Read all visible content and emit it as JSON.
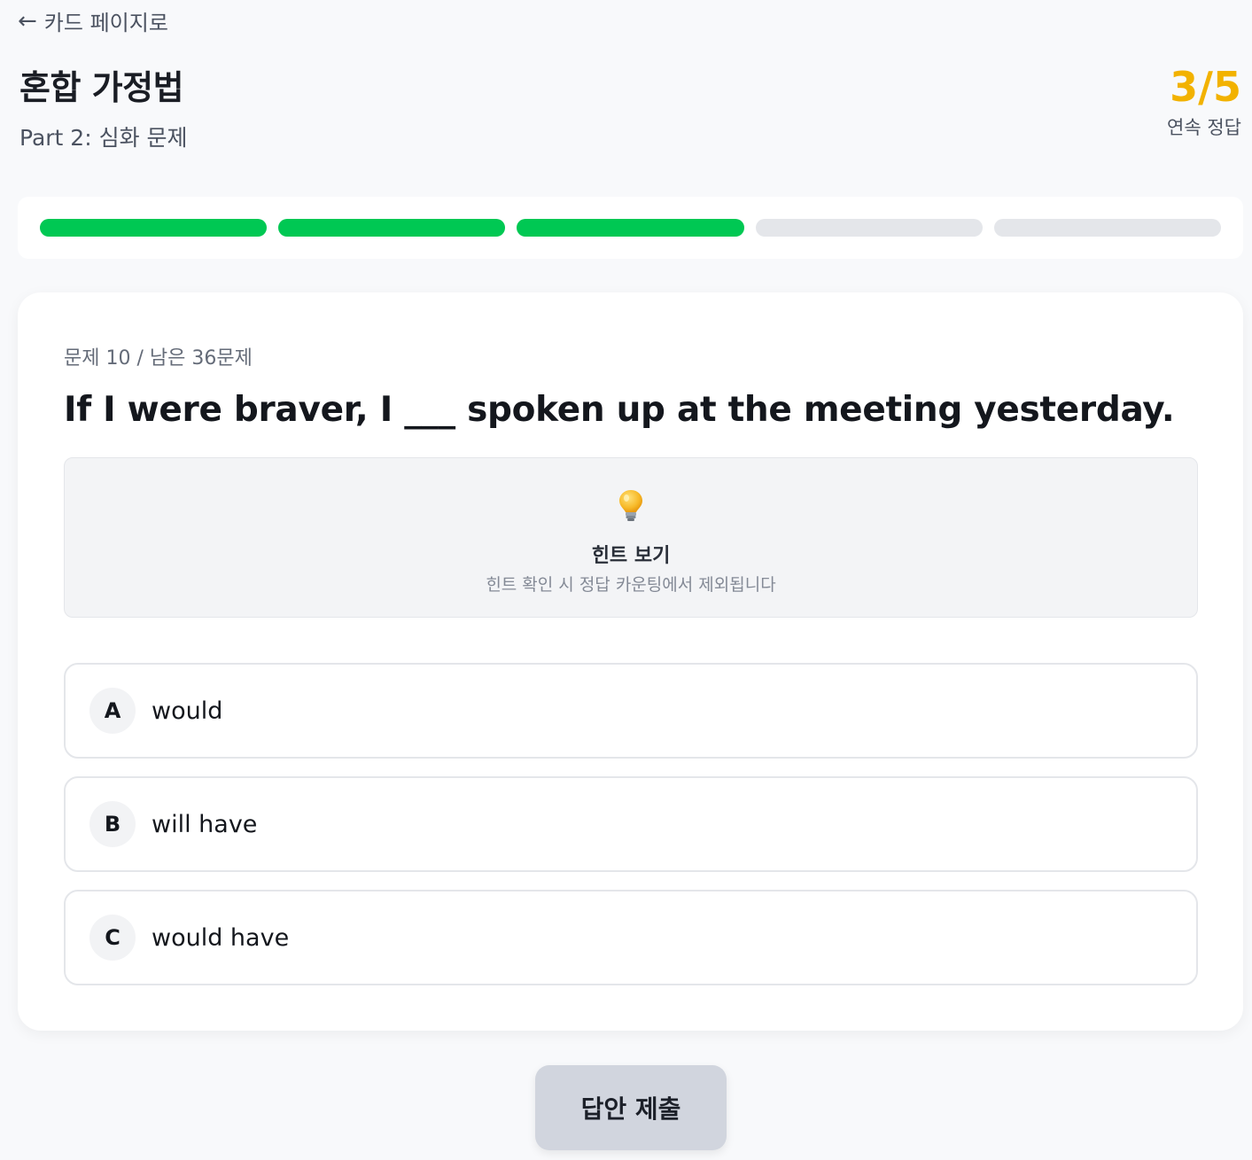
{
  "header": {
    "back_label": "카드 페이지로",
    "title": "혼합 가정법",
    "subtitle": "Part 2: 심화 문제"
  },
  "streak": {
    "count": "3/5",
    "label": "연속 정답",
    "color": "#f2b200"
  },
  "progress": {
    "completed": 3,
    "total": 5,
    "done_color": "#00c853",
    "pending_color": "#e4e6ea"
  },
  "question": {
    "meta": "문제 10 / 남은 36문제",
    "text": "If I were braver, I ___ spoken up at the meeting yesterday."
  },
  "hint": {
    "icon": "lightbulb-icon",
    "title": "힌트 보기",
    "description": "힌트 확인 시 정답 카운팅에서 제외됩니다"
  },
  "options": [
    {
      "letter": "A",
      "text": "would"
    },
    {
      "letter": "B",
      "text": "will have"
    },
    {
      "letter": "C",
      "text": "would have"
    }
  ],
  "submit": {
    "label": "답안 제출"
  }
}
